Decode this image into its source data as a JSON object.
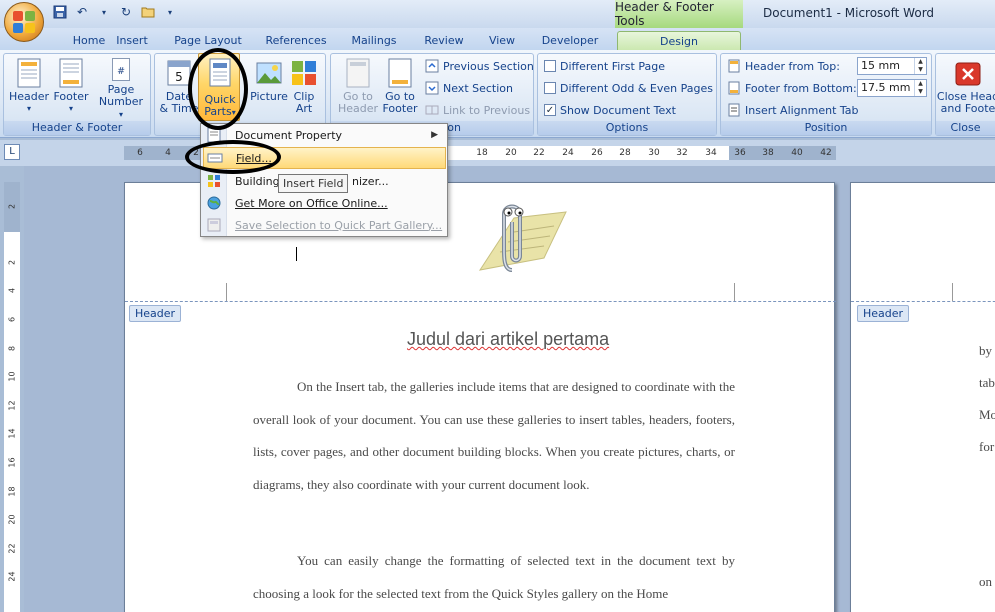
{
  "window": {
    "title": "Document1 - Microsoft Word",
    "contextual_title": "Header & Footer Tools"
  },
  "tabs": [
    {
      "label": "Home"
    },
    {
      "label": "Insert"
    },
    {
      "label": "Page Layout"
    },
    {
      "label": "References"
    },
    {
      "label": "Mailings"
    },
    {
      "label": "Review"
    },
    {
      "label": "View"
    },
    {
      "label": "Developer"
    },
    {
      "label": "Design",
      "active": true
    }
  ],
  "ribbon": {
    "header_footer": {
      "label": "Header & Footer",
      "header": "Header",
      "footer": "Footer",
      "page_number_line1": "Page",
      "page_number_line2": "Number"
    },
    "insert": {
      "date_line1": "Date",
      "date_line2": "& Time",
      "quick_parts_line1": "Quick",
      "quick_parts_line2": "Parts",
      "picture": "Picture",
      "clip_art_line1": "Clip",
      "clip_art_line2": "Art"
    },
    "navigation": {
      "label_partial": "ion",
      "goto_header_line1": "Go to",
      "goto_header_line2": "Header",
      "goto_footer_line1": "Go to",
      "goto_footer_line2": "Footer",
      "previous_section": "Previous Section",
      "next_section": "Next Section",
      "link_to_previous": "Link to Previous"
    },
    "options": {
      "label": "Options",
      "different_first_page": "Different First Page",
      "different_odd_even": "Different Odd & Even Pages",
      "show_document_text": "Show Document Text",
      "show_document_text_checked": true
    },
    "position": {
      "label": "Position",
      "header_from_top_label": "Header from Top:",
      "header_from_top_value": "15 mm",
      "footer_from_bottom_label": "Footer from Bottom:",
      "footer_from_bottom_value": "17.5 mm",
      "insert_alignment_tab": "Insert Alignment Tab"
    },
    "close": {
      "label": "Close",
      "close_line1": "Close Head",
      "close_line2": "and Foote"
    }
  },
  "menu": {
    "document_property": "Document Property",
    "field": "Field...",
    "building_blocks_start": "Building",
    "building_blocks_end": "nizer...",
    "get_more": "Get More on Office Online...",
    "save_selection": "Save Selection to Quick Part Gallery...",
    "tooltip": "Insert Field"
  },
  "ruler": {
    "h_ticks": [
      "6",
      "4",
      "2",
      "18",
      "20",
      "22",
      "24",
      "26",
      "28",
      "30",
      "32",
      "34",
      "36",
      "38",
      "40",
      "42"
    ],
    "v_ticks": [
      "2",
      "2",
      "4",
      "6",
      "8",
      "10",
      "12",
      "14",
      "16",
      "18",
      "20",
      "22",
      "24"
    ]
  },
  "document": {
    "header_tag": "Header",
    "title": "Judul dari artikel pertama",
    "paragraph1": "On the Insert tab, the galleries include items that are designed to coordinate with the overall look of your document. You can use these galleries to insert tables, headers, footers, lists, cover pages, and other document building blocks. When you create pictures, charts, or diagrams, they also coordinate with your current document look.",
    "paragraph2": "You can easily change the formatting of selected text in the document text by choosing a look for the selected text from the Quick Styles gallery on the Home",
    "right_page_header_tag": "Header",
    "right_page_fragments": [
      "by",
      "tab",
      "Mo",
      "for",
      "on"
    ]
  },
  "colors": {
    "ribbon_text": "#15428b",
    "highlight": "#ffd668",
    "contextual_green": "#a6d97e"
  }
}
